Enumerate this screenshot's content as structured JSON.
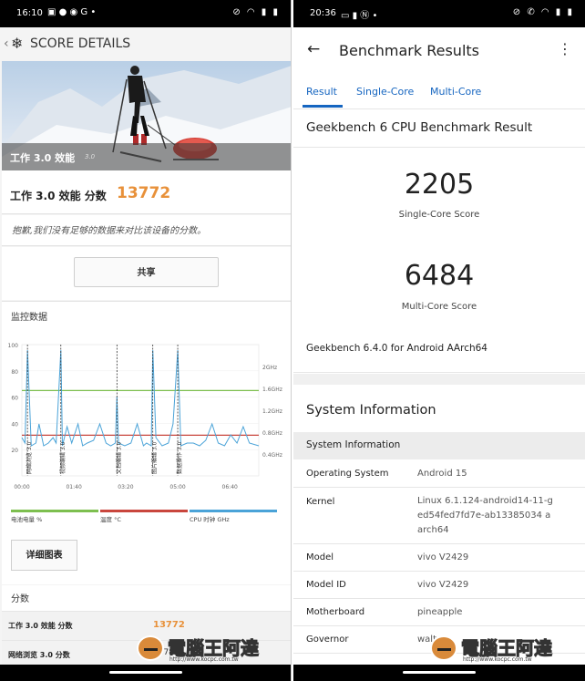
{
  "left": {
    "status": {
      "time": "16:10"
    },
    "title": "SCORE DETAILS",
    "hero_caption": "工作 3.0 效能",
    "hero_version": "3.0",
    "score_label": "工作 3.0 效能 分数",
    "score_value": "13772",
    "sorry_text": "抱歉,我们没有足够的数据来对比该设备的分数。",
    "share_button": "共享",
    "monitor_heading": "监控数据",
    "detail_button": "详细图表",
    "scores_heading": "分数",
    "score_rows": [
      {
        "name": "工作 3.0 效能 分数",
        "value": "13772"
      },
      {
        "name": "网络浏览 3.0 分数",
        "value": "10785"
      }
    ],
    "colors": {
      "accent": "#e8913a",
      "battery": "#7dbf4f",
      "temp": "#c9463d",
      "cpu": "#4aa3d8"
    }
  },
  "chart_data": {
    "type": "line",
    "title": "",
    "x_ticks": [
      "00:00",
      "01:40",
      "03:20",
      "05:00",
      "06:40"
    ],
    "y_left_ticks": [
      "100",
      "80",
      "60",
      "40",
      "20"
    ],
    "y_right_ticks": [
      "2GHz",
      "1.6GHz",
      "1.2GHz",
      "0.8GHz",
      "0.4GHz"
    ],
    "ylim_left": [
      0,
      100
    ],
    "ylim_right": [
      0,
      2.4
    ],
    "xlim": [
      0,
      7.6
    ],
    "markers": [
      {
        "x": 0.18,
        "label": "网络浏览 3.0"
      },
      {
        "x": 1.25,
        "label": "视频编辑 3.0"
      },
      {
        "x": 3.05,
        "label": "文档编辑 3.0"
      },
      {
        "x": 4.2,
        "label": "图片编辑 3.0"
      },
      {
        "x": 5.0,
        "label": "数据操作 3.0"
      }
    ],
    "series": [
      {
        "name": "电池电量 %",
        "axis": "left",
        "x": [
          0,
          7.6
        ],
        "values": [
          65,
          65
        ]
      },
      {
        "name": "温度 °C",
        "axis": "left",
        "x": [
          0,
          7.6
        ],
        "values": [
          31,
          31
        ]
      },
      {
        "name": "CPU 时钟 GHz",
        "axis": "right",
        "x": [
          0,
          0.1,
          0.18,
          0.3,
          0.45,
          0.55,
          0.7,
          0.85,
          1.0,
          1.1,
          1.25,
          1.3,
          1.45,
          1.6,
          1.8,
          1.95,
          2.1,
          2.3,
          2.5,
          2.7,
          2.85,
          3.0,
          3.05,
          3.1,
          3.3,
          3.5,
          3.7,
          3.9,
          4.0,
          4.15,
          4.2,
          4.3,
          4.5,
          4.7,
          4.85,
          5.0,
          5.1,
          5.3,
          5.5,
          5.7,
          5.9,
          6.1,
          6.3,
          6.5,
          6.7,
          6.9,
          7.1,
          7.3,
          7.6
        ],
        "values": [
          0.7,
          0.6,
          2.3,
          0.55,
          0.6,
          0.95,
          0.55,
          0.6,
          0.7,
          0.6,
          2.3,
          0.55,
          0.9,
          0.6,
          0.95,
          0.55,
          0.6,
          0.65,
          0.95,
          0.6,
          0.55,
          0.6,
          1.45,
          0.6,
          0.55,
          0.6,
          0.95,
          0.55,
          0.6,
          0.55,
          2.3,
          0.7,
          0.55,
          0.6,
          0.95,
          2.3,
          0.55,
          0.6,
          0.6,
          0.55,
          0.65,
          0.95,
          0.6,
          0.55,
          0.75,
          0.6,
          0.9,
          0.6,
          0.55
        ]
      }
    ]
  },
  "right": {
    "status": {
      "time": "20:36"
    },
    "app_title": "Benchmark Results",
    "tabs": [
      "Result",
      "Single-Core",
      "Multi-Core"
    ],
    "result_heading": "Geekbench 6 CPU Benchmark Result",
    "single_score": "2205",
    "single_label": "Single-Core Score",
    "multi_score": "6484",
    "multi_label": "Multi-Core Score",
    "version_line": "Geekbench 6.4.0 for Android AArch64",
    "sysinfo_heading": "System Information",
    "sysinfo_subheading": "System Information",
    "rows": [
      {
        "key": "Operating System",
        "value": "Android 15"
      },
      {
        "key": "Kernel",
        "value": "Linux 6.1.124-android14-11-ged54fed7fd7e-ab13385034 aarch64"
      },
      {
        "key": "Model",
        "value": "vivo V2429"
      },
      {
        "key": "Model ID",
        "value": "vivo V2429"
      },
      {
        "key": "Motherboard",
        "value": "pineapple"
      },
      {
        "key": "Governor",
        "value": "walt"
      }
    ],
    "accent": "#1565c0"
  },
  "watermark": {
    "text": "電腦王阿達",
    "url": "http://www.kocpc.com.tw"
  }
}
